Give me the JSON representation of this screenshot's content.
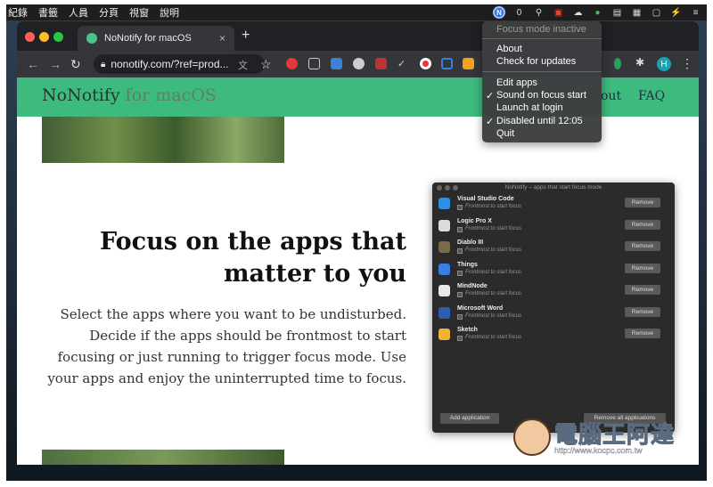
{
  "menubar": {
    "items": [
      "紀錄",
      "書籤",
      "人員",
      "分頁",
      "視窗",
      "說明"
    ],
    "tray_counter": "0"
  },
  "browser": {
    "tab_title": "NoNotify for macOS",
    "tab_close": "×",
    "new_tab": "+",
    "url": "nonotify.com/?ref=prod...",
    "avatar_letter": "H"
  },
  "site": {
    "logo_main": "NoNotify",
    "logo_sub": "for macOS",
    "nav": [
      "out",
      "FAQ"
    ],
    "heading": "Focus on the apps that matter to you",
    "paragraph": "Select the apps where you want to be undisturbed. Decide if the apps should be frontmost to start focusing or just running to trigger focus mode. Use your apps and enjoy the uninterrupted time to focus."
  },
  "app_window": {
    "title": "NoNotify – apps that start focus mode",
    "checkbox_label": "Frontmost to start focus",
    "remove_label": "Remove",
    "apps": [
      {
        "name": "Visual Studio Code",
        "color": "#2f8fe0"
      },
      {
        "name": "Logic Pro X",
        "color": "#ddd"
      },
      {
        "name": "Diablo III",
        "color": "#7a6a4a"
      },
      {
        "name": "Things",
        "color": "#3b7de0"
      },
      {
        "name": "MindNode",
        "color": "#e8e8e8"
      },
      {
        "name": "Microsoft Word",
        "color": "#2b5fb5"
      },
      {
        "name": "Sketch",
        "color": "#f2b233"
      }
    ],
    "add_button": "Add application",
    "remove_all_button": "Remove all applications"
  },
  "tray_menu": {
    "status": "Focus mode inactive",
    "about": "About",
    "check_updates": "Check for updates",
    "edit_apps": "Edit apps",
    "sound": "Sound on focus start",
    "launch": "Launch at login",
    "disabled": "Disabled until 12:05",
    "quit": "Quit",
    "check": "✓"
  },
  "watermark": {
    "text": "電腦王阿達",
    "url": "http://www.kocpc.com.tw"
  },
  "colors": {
    "site_header": "#3dba7e",
    "tray_accent": "#2f6fe0"
  }
}
